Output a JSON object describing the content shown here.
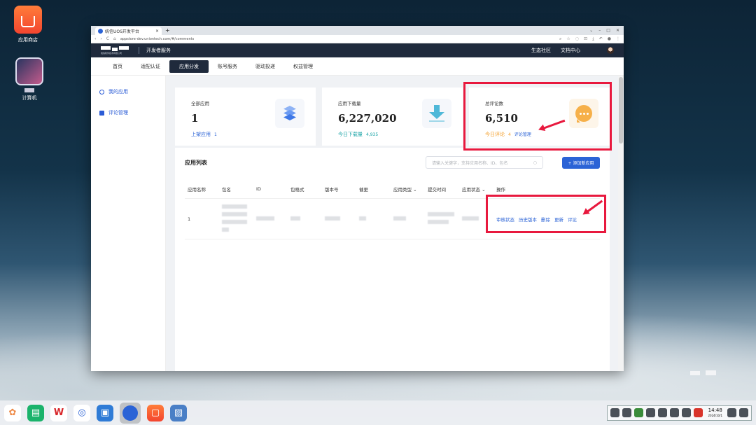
{
  "desktop": {
    "icons": [
      {
        "label": "应用商店"
      },
      {
        "label": "计算机"
      }
    ]
  },
  "browser": {
    "tab_title": "统信UOS开发平台",
    "new_tab": "+",
    "window_controls": [
      "⌄",
      "–",
      "□",
      "✕"
    ],
    "nav": [
      "‹",
      "›",
      "C",
      "⌂"
    ],
    "url": "appstore-dev.uniontech.com/#/comments"
  },
  "topnav": {
    "logo_text": "统信软件技术有限公司",
    "title": "开发者服务",
    "links": [
      "生态社区",
      "文档中心"
    ]
  },
  "menubar": {
    "items": [
      "首页",
      "适配认证",
      "应用分发",
      "账号服务",
      "驱动投递",
      "权益管理"
    ],
    "active": "应用分发"
  },
  "sidebar": {
    "items": [
      {
        "label": "我的应用",
        "icon": "app-icon"
      },
      {
        "label": "评论管理",
        "icon": "comment-icon"
      }
    ]
  },
  "cards": {
    "all_apps": {
      "title": "全部应用",
      "value": "1",
      "foot_label": "上架应用",
      "foot_value": "1",
      "icon": "layers-icon"
    },
    "downloads": {
      "title": "应用下载量",
      "value": "6,227,020",
      "foot_label": "今日下载量",
      "foot_value": "4,935",
      "icon": "download-icon"
    },
    "comments": {
      "title": "总评论数",
      "value": "6,510",
      "foot_label": "今日评论",
      "foot_value": "4",
      "link": "评论管理",
      "icon": "chat-bubble-icon"
    }
  },
  "app_list": {
    "title": "应用列表",
    "search_placeholder": "请输入关键字，支持应用名称、ID、包名",
    "add_button": "+ 添加新应用",
    "columns": [
      "应用名称",
      "包名",
      "ID",
      "包格式",
      "版本号",
      "催更",
      "应用类型",
      "提交时间",
      "应用状态",
      "操作"
    ],
    "rows": [
      {
        "name": "1",
        "ops": [
          "审核状态",
          "历史版本",
          "删除",
          "更新",
          "评论"
        ]
      }
    ]
  },
  "taskbar": {
    "clock_time": "14:48",
    "clock_date": "2024/10/1"
  },
  "colors": {
    "nav_dark": "#1f2a3c",
    "accent_blue": "#2b63d6",
    "highlight_red": "#e8193e",
    "teal": "#18a3a6",
    "orange": "#f39a1f"
  }
}
